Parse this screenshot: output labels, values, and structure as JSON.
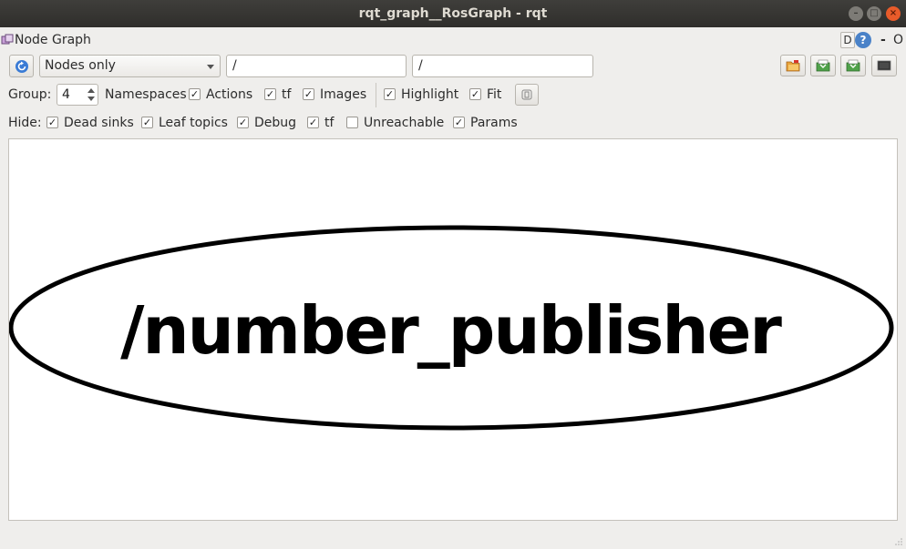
{
  "window": {
    "title": "rqt_graph__RosGraph - rqt",
    "controls": {
      "minimize": "–",
      "maximize": "□",
      "close": "×"
    }
  },
  "plugin_header": {
    "title": "Node Graph",
    "d_button": "D",
    "help_button": "?",
    "minimize": "-",
    "close": "O"
  },
  "toolbar": {
    "refresh_icon": "refresh-icon",
    "view_mode": "Nodes only",
    "filter_include": "/",
    "filter_exclude": "/",
    "right_buttons": [
      "load-dot-icon",
      "save-dot-icon",
      "save-svg-icon",
      "save-image-icon"
    ]
  },
  "options": {
    "group_label": "Group:",
    "group_value": "4",
    "namespaces_label": "Namespaces",
    "actions_label": "Actions",
    "actions_checked": true,
    "tf_label": "tf",
    "tf_checked": true,
    "images_label": "Images",
    "images_checked": true,
    "highlight_label": "Highlight",
    "highlight_checked": true,
    "fit_label": "Fit",
    "fit_checked": true
  },
  "hide": {
    "label": "Hide:",
    "dead_sinks_label": "Dead sinks",
    "dead_sinks_checked": true,
    "leaf_topics_label": "Leaf topics",
    "leaf_topics_checked": true,
    "debug_label": "Debug",
    "debug_checked": true,
    "tf_label": "tf",
    "tf_checked": true,
    "unreachable_label": "Unreachable",
    "unreachable_checked": false,
    "params_label": "Params",
    "params_checked": true
  },
  "graph": {
    "nodes": [
      {
        "name": "/number_publisher"
      }
    ]
  }
}
